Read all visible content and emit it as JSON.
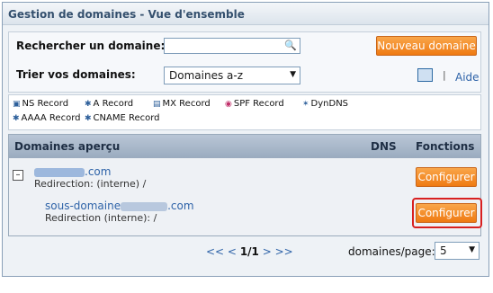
{
  "header": {
    "title": "Gestion de domaines - Vue d'ensemble"
  },
  "search": {
    "label": "Rechercher un domaine:",
    "input_value": "",
    "new_button": "Nouveau domaine",
    "sort_label": "Trier vos domaines:",
    "sort_value": "Domaines a-z",
    "separator": "|",
    "help_link": "Aide"
  },
  "legend": {
    "items": [
      "NS Record",
      "A Record",
      "MX Record",
      "SPF Record",
      "DynDNS",
      "AAAA Record",
      "CNAME Record"
    ]
  },
  "table": {
    "headers": {
      "domains": "Domaines aperçu",
      "dns": "DNS",
      "functions": "Fonctions"
    },
    "rows": [
      {
        "domain_suffix": ".com",
        "redirect": "Redirection: (interne) /",
        "action": "Configurer"
      },
      {
        "domain_prefix": "sous-domaine",
        "domain_suffix": ".com",
        "redirect": "Redirection (interne): /",
        "action": "Configurer"
      }
    ]
  },
  "pagination": {
    "prev": "<< <",
    "current": "1/1",
    "next": "> >>",
    "per_page_label": "domaines/page:",
    "per_page_value": "5"
  },
  "colors": {
    "accent": "#ef7a12",
    "link": "#2e63a8",
    "highlight": "#d82020"
  }
}
